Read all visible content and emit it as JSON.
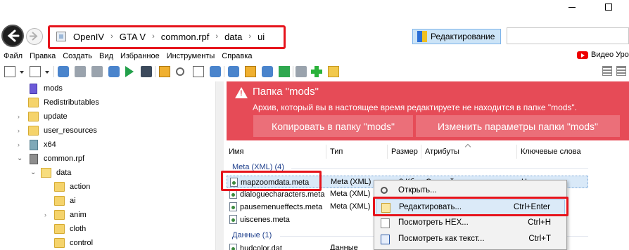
{
  "nav": {
    "breadcrumb": [
      "OpenIV",
      "GTA V",
      "common.rpf",
      "data",
      "ui"
    ],
    "edit_mode_label": "Редактирование",
    "search_placeholder": ""
  },
  "menu": [
    "Файл",
    "Правка",
    "Создать",
    "Вид",
    "Избранное",
    "Инструменты",
    "Справка"
  ],
  "youtube_label": "Видео Уро",
  "tree": {
    "items": [
      {
        "label": "mods",
        "icon": "mods-archive-icon",
        "expander": "none"
      },
      {
        "label": "Redistributables",
        "icon": "folder-icon",
        "expander": "none"
      },
      {
        "label": "update",
        "icon": "folder-icon",
        "expander": "collapsed"
      },
      {
        "label": "user_resources",
        "icon": "folder-icon",
        "expander": "collapsed"
      },
      {
        "label": "x64",
        "icon": "x64-archive-icon",
        "expander": "collapsed"
      },
      {
        "label": "common.rpf",
        "icon": "rpf-archive-icon",
        "expander": "expanded"
      },
      {
        "label": "data",
        "icon": "open-folder-icon",
        "expander": "expanded"
      },
      {
        "label": "action",
        "icon": "folder-icon",
        "expander": "none"
      },
      {
        "label": "ai",
        "icon": "folder-icon",
        "expander": "none"
      },
      {
        "label": "anim",
        "icon": "folder-icon",
        "expander": "collapsed"
      },
      {
        "label": "cloth",
        "icon": "folder-icon",
        "expander": "none"
      },
      {
        "label": "control",
        "icon": "folder-icon",
        "expander": "none"
      }
    ]
  },
  "alert": {
    "title": "Папка \"mods\"",
    "message": "Архив, который вы в настоящее время редактируете не находится в папке \"mods\".",
    "button_copy": "Копировать в папку \"mods\"",
    "button_settings": "Изменить параметры папки \"mods\"",
    "color": "#e64b57"
  },
  "list": {
    "columns": [
      "Имя",
      "Тип",
      "Размер",
      "Атрибуты",
      "Ключевые слова"
    ],
    "groups": [
      {
        "title": "Meta (XML) (4)",
        "files": [
          {
            "name": "mapzoomdata.meta",
            "type": "Meta (XML)",
            "size": "2 Кб",
            "attrs": "Сжатый",
            "keys": "Нет",
            "selected": true
          },
          {
            "name": "dialoguecharacters.meta",
            "type": "Meta (XML)",
            "size": "",
            "attrs": "",
            "keys": "",
            "selected": false
          },
          {
            "name": "pausemenueffects.meta",
            "type": "Meta (XML)",
            "size": "",
            "attrs": "",
            "keys": "",
            "selected": false
          },
          {
            "name": "uiscenes.meta",
            "type": "Meta (XML)",
            "size": "",
            "attrs": "",
            "keys": "",
            "selected": false
          }
        ]
      },
      {
        "title": "Данные (1)",
        "files": [
          {
            "name": "hudcolor.dat",
            "type": "Данные",
            "size": "",
            "attrs": "",
            "keys": "",
            "selected": false
          }
        ]
      }
    ]
  },
  "context_menu": [
    {
      "label": "Открыть...",
      "shortcut": "",
      "icon": "open-icon",
      "highlighted": false
    },
    {
      "label": "Редактировать...",
      "shortcut": "Ctrl+Enter",
      "icon": "edit-icon",
      "highlighted": true
    },
    {
      "label": "Посмотреть HEX...",
      "shortcut": "Ctrl+H",
      "icon": "hex-icon",
      "highlighted": false
    },
    {
      "label": "Посмотреть как текст...",
      "shortcut": "Ctrl+T",
      "icon": "text-icon",
      "highlighted": false
    }
  ]
}
